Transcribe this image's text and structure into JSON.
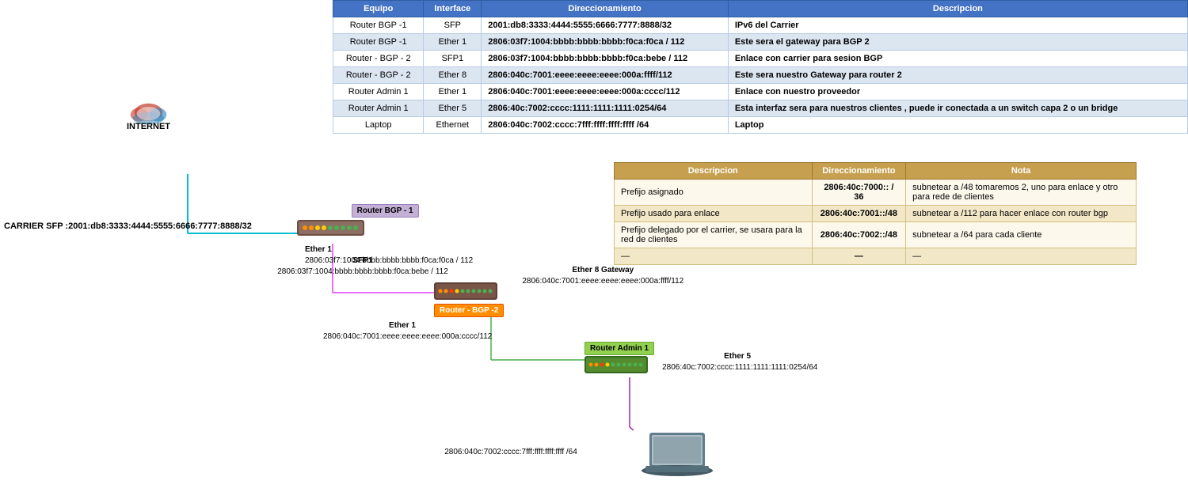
{
  "topTable": {
    "headers": [
      "Equipo",
      "Interface",
      "Direccionamiento",
      "Descripcion"
    ],
    "rows": [
      [
        "Router BGP -1",
        "SFP",
        "2001:db8:3333:4444:5555:6666:7777:8888/32",
        "IPv6 del Carrier"
      ],
      [
        "Router BGP -1",
        "Ether 1",
        "2806:03f7:1004:bbbb:bbbb:bbbb:f0ca:f0ca / 112",
        "Este sera el gateway para BGP 2"
      ],
      [
        "Router - BGP - 2",
        "SFP1",
        "2806:03f7:1004:bbbb:bbbb:bbbb:f0ca:bebe / 112",
        "Enlace con carrier para sesion BGP"
      ],
      [
        "Router - BGP - 2",
        "Ether 8",
        "2806:040c:7001:eeee:eeee:eeee:000a:ffff/112",
        "Este sera nuestro Gateway para router 2"
      ],
      [
        "Router Admin 1",
        "Ether 1",
        "2806:040c:7001:eeee:eeee:eeee:000a:cccc/112",
        "Enlace con nuestro proveedor"
      ],
      [
        "Router Admin 1",
        "Ether 5",
        "2806:40c:7002:cccc:1111:1111:1111:0254/64",
        "Esta interfaz sera para nuestros clientes , puede ir conectada a un switch capa 2 o un bridge"
      ],
      [
        "Laptop",
        "Ethernet",
        "2806:040c:7002:cccc:7fff:ffff:ffff:ffff /64",
        "Laptop"
      ]
    ]
  },
  "bottomTable": {
    "headers": [
      "Descripcion",
      "Direccionamiento",
      "Nota"
    ],
    "rows": [
      [
        "Prefijo asignado",
        "2806:40c:7000:: / 36",
        "subnetear a /48  tomaremos 2, uno para enlace y otro para rede de clientes"
      ],
      [
        "Prefijo usado para enlace",
        "2806:40c:7001::/48",
        "subnetear a /112 para hacer enlace con router bgp"
      ],
      [
        "Prefijo delegado por el carrier, se usara para la red de clientes",
        "2806:40c:7002::/48",
        "subnetear a /64 para cada cliente"
      ],
      [
        "—",
        "—",
        "—"
      ]
    ]
  },
  "diagram": {
    "internet": {
      "label": "INTERNET"
    },
    "carrier": {
      "label": "CARRIER\nSFP :2001:db8:3333:4444:5555:6666:7777:8888/32"
    },
    "routerBGP1": {
      "label": "Router BGP -\n1",
      "ether1_name": "Ether 1",
      "ether1_addr": "2806:03f7:1004:bbbb:bbbb:bbbb:f0ca:f0ca / 112"
    },
    "routerBGP2": {
      "label": "Router - BGP -2",
      "sfp1_name": "SFP1",
      "sfp1_addr": "2806:03f7:1004:bbbb:bbbb:bbbb:f0ca:bebe / 112",
      "ether8_name": "Ether 8 Gateway",
      "ether8_addr": "2806:040c:7001:eeee:eeee:eeee:000a:ffff/112",
      "ether1_name": "Ether 1",
      "ether1_addr": "2806:040c:7001:eeee:eeee:eeee:000a:cccc/112"
    },
    "routerAdmin1": {
      "label": "Router Admin 1",
      "ether5_name": "Ether 5",
      "ether5_addr": "2806:40c:7002:cccc:1111:1111:1111:0254/64"
    },
    "laptop": {
      "addr": "2806:040c:7002:cccc:7fff:ffff:ffff:ffff /64"
    }
  }
}
